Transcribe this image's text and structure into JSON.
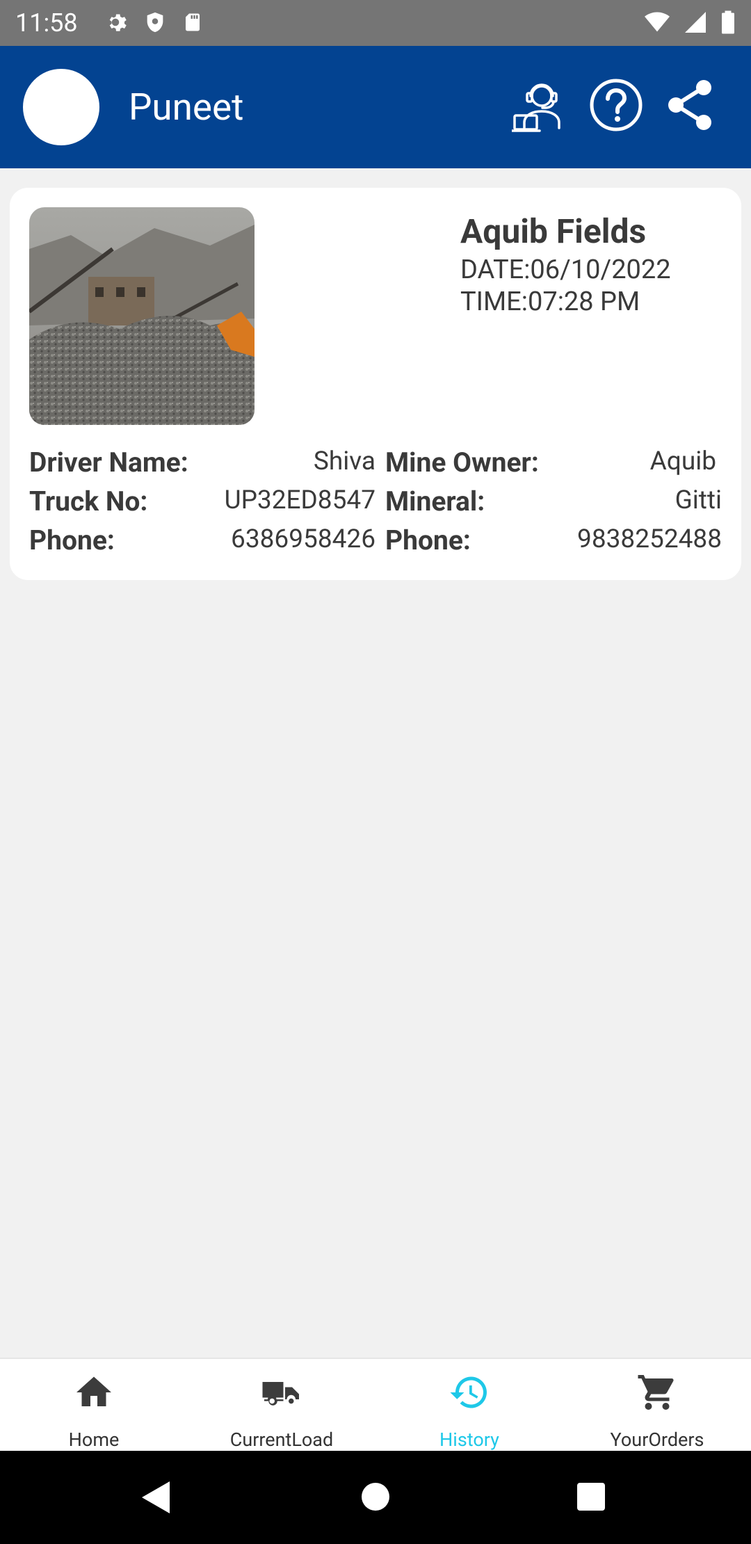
{
  "status": {
    "time": "11:58"
  },
  "app_bar": {
    "user_name": "Puneet"
  },
  "card": {
    "title": "Aquib Fields",
    "date": "DATE:06/10/2022",
    "time": "TIME:07:28 PM",
    "rows": [
      {
        "l1": "Driver Name:",
        "v1": "Shiva",
        "l2": "Mine Owner:",
        "v2": "Aquib"
      },
      {
        "l1": "Truck No:",
        "v1": "UP32ED8547",
        "l2": "Mineral:",
        "v2": "Gitti"
      },
      {
        "l1": "Phone:",
        "v1": "6386958426",
        "l2": "Phone:",
        "v2": "9838252488"
      }
    ]
  },
  "nav": {
    "items": [
      {
        "label": "Home",
        "icon": "home-icon"
      },
      {
        "label": "CurrentLoad",
        "icon": "truck-icon"
      },
      {
        "label": "History",
        "icon": "history-icon"
      },
      {
        "label": "YourOrders",
        "icon": "cart-icon"
      }
    ],
    "active_color": "#1ec8e8"
  },
  "colors": {
    "app_bar": "#034391",
    "background": "#f1f1f1"
  }
}
